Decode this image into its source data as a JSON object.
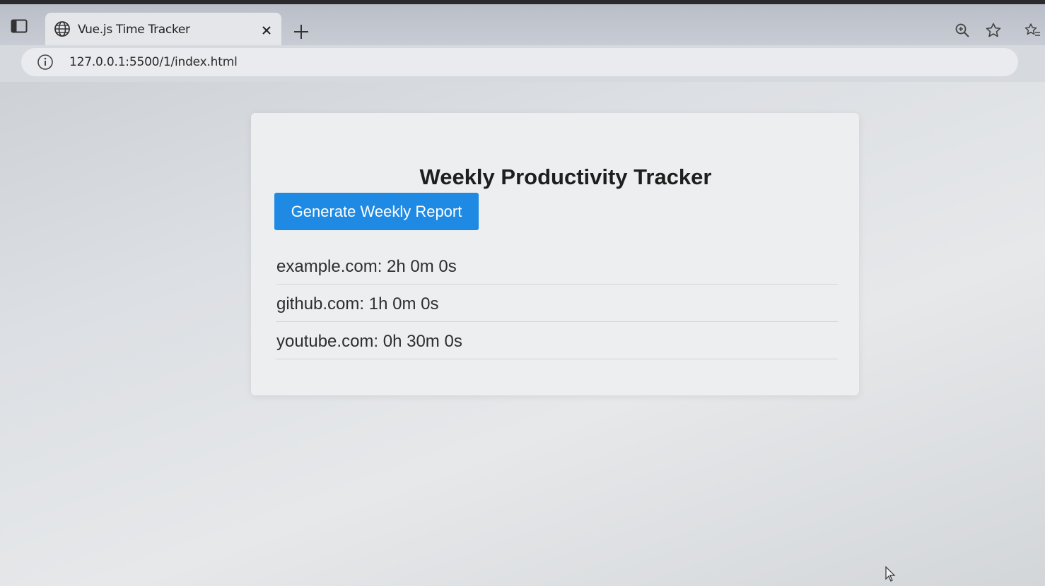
{
  "browser": {
    "tab": {
      "title": "Vue.js Time Tracker"
    },
    "address_bar": {
      "url": "127.0.0.1:5500/1/index.html"
    }
  },
  "app": {
    "title": "Weekly Productivity Tracker",
    "button_label": "Generate Weekly Report",
    "accent_color": "#1f8ae3",
    "report": [
      {
        "text": "example.com: 2h 0m 0s"
      },
      {
        "text": "github.com: 1h 0m 0s"
      },
      {
        "text": "youtube.com: 0h 30m 0s"
      }
    ]
  }
}
